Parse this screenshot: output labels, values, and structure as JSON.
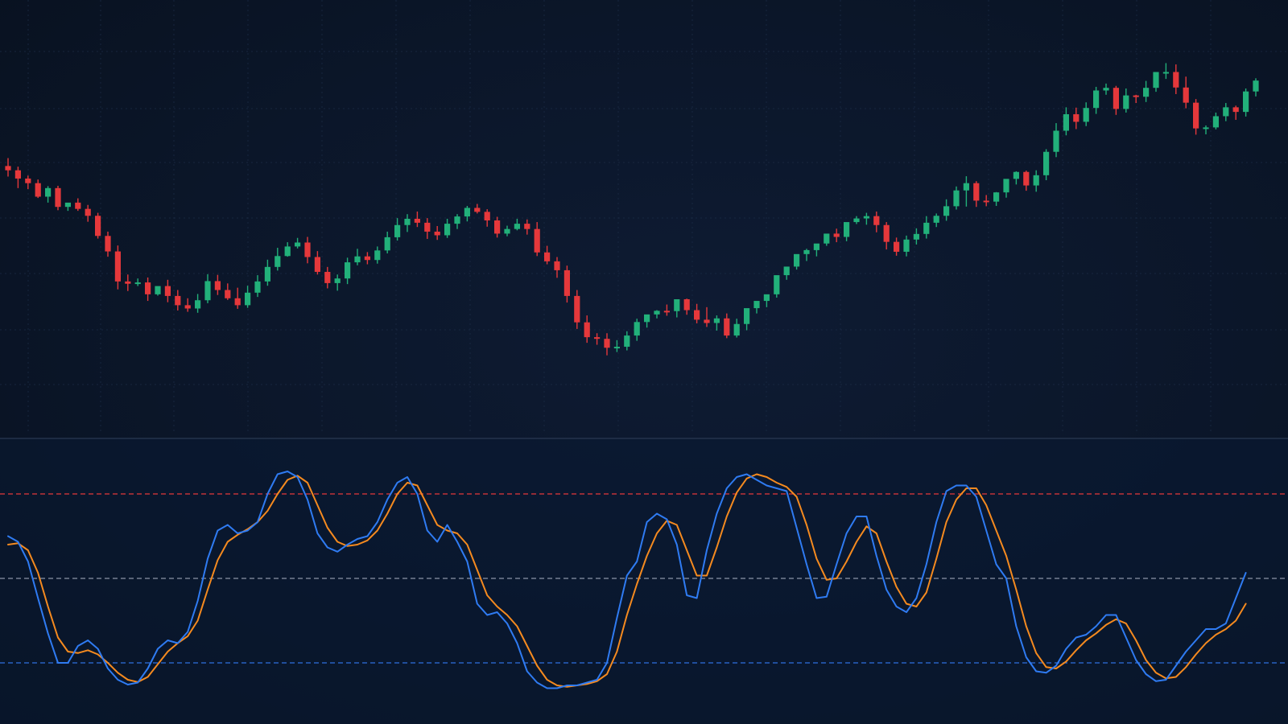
{
  "colors": {
    "bull": "#22b07a",
    "bear": "#e5383b",
    "k_line": "#2f7bf2",
    "d_line": "#f58a1f",
    "overbought_line": "#e5383b",
    "midline": "#8a94a6",
    "oversold_line": "#2f6fe0"
  },
  "chart_data": [
    {
      "type": "candlestick",
      "pane": "price",
      "grid": true,
      "legend": "none",
      "ylim": [
        0,
        100
      ],
      "x": [
        0,
        1,
        2,
        3,
        4,
        5,
        6,
        7,
        8,
        9,
        10,
        11,
        12,
        13,
        14,
        15,
        16,
        17,
        18,
        19,
        20,
        21,
        22,
        23,
        24,
        25,
        26,
        27,
        28,
        29,
        30,
        31,
        32,
        33,
        34,
        35,
        36,
        37,
        38,
        39,
        40,
        41,
        42,
        43,
        44,
        45,
        46,
        47,
        48,
        49,
        50,
        51,
        52,
        53,
        54,
        55,
        56,
        57,
        58,
        59,
        60,
        61,
        62,
        63,
        64,
        65,
        66,
        67,
        68,
        69,
        70,
        71,
        72,
        73,
        74,
        75,
        76,
        77,
        78,
        79,
        80,
        81,
        82,
        83,
        84,
        85,
        86,
        87,
        88,
        89,
        90,
        91,
        92,
        93,
        94,
        95,
        96,
        97,
        98,
        99,
        100,
        101,
        102,
        103,
        104,
        105,
        106,
        107,
        108,
        109,
        110,
        111,
        112,
        113,
        114,
        115,
        116,
        117,
        118,
        119,
        120,
        121,
        122,
        123,
        124,
        125
      ],
      "open": [
        70.4,
        69.1,
        66.6,
        65.2,
        61.1,
        63.7,
        58.0,
        59.3,
        57.4,
        55.3,
        49.2,
        44.5,
        35.4,
        34.7,
        35.1,
        31.5,
        34.0,
        31.0,
        28.2,
        27.2,
        29.7,
        35.5,
        32.8,
        30.3,
        28.2,
        32.0,
        35.4,
        39.8,
        43.1,
        46.0,
        47.2,
        42.8,
        38.3,
        34.9,
        36.3,
        41.2,
        43.0,
        41.9,
        44.8,
        48.8,
        52.5,
        54.4,
        53.2,
        50.5,
        49.4,
        52.9,
        55.1,
        57.7,
        56.5,
        53.9,
        49.9,
        51.3,
        52.9,
        51.3,
        44.2,
        41.5,
        38.8,
        31.0,
        23.0,
        18.5,
        18.0,
        15.3,
        15.6,
        19.0,
        23.1,
        25.4,
        26.5,
        26.4,
        30.0,
        26.7,
        23.8,
        22.8,
        24.2,
        19.0,
        22.5,
        27.3,
        29.5,
        31.5,
        37.3,
        39.9,
        43.7,
        44.9,
        46.9,
        49.9,
        48.9,
        53.4,
        54.5,
        55.2,
        52.5,
        47.4,
        44.4,
        48.1,
        49.8,
        53.2,
        55.3,
        58.2,
        63.0,
        65.2,
        59.9,
        59.6,
        62.4,
        66.5,
        68.6,
        64.5,
        67.6,
        74.7,
        81.1,
        86.1,
        83.8,
        88.0,
        93.3,
        94.1,
        87.7,
        91.8,
        91.4,
        94.1,
        98.9,
        98.9,
        94.2,
        89.6,
        81.8,
        82.1,
        85.5,
        88.2,
        86.8,
        93.0
      ],
      "close": [
        69.1,
        66.6,
        65.2,
        61.1,
        63.7,
        58.0,
        59.3,
        57.4,
        55.3,
        49.2,
        44.5,
        35.4,
        34.7,
        35.1,
        31.5,
        34.0,
        31.0,
        28.2,
        27.2,
        29.7,
        35.5,
        32.8,
        30.3,
        28.2,
        32.0,
        35.4,
        39.8,
        43.1,
        46.0,
        47.2,
        42.8,
        38.3,
        34.9,
        36.3,
        41.2,
        43.0,
        41.9,
        44.8,
        48.8,
        52.5,
        54.4,
        53.2,
        50.5,
        49.4,
        52.9,
        55.1,
        57.7,
        56.5,
        53.9,
        49.9,
        51.3,
        52.9,
        51.3,
        44.2,
        41.5,
        38.8,
        31.0,
        23.0,
        18.5,
        18.0,
        15.3,
        15.6,
        19.0,
        23.1,
        25.4,
        26.5,
        26.4,
        30.0,
        26.7,
        23.8,
        22.8,
        24.2,
        19.0,
        22.5,
        27.3,
        29.5,
        31.5,
        37.3,
        39.9,
        43.7,
        44.9,
        46.9,
        49.9,
        48.9,
        53.4,
        54.5,
        55.2,
        52.5,
        47.4,
        44.4,
        48.1,
        49.8,
        53.2,
        55.3,
        58.2,
        63.0,
        65.2,
        59.9,
        59.6,
        62.4,
        66.5,
        68.6,
        64.5,
        67.6,
        74.7,
        81.1,
        86.1,
        83.8,
        88.0,
        93.3,
        94.1,
        87.7,
        91.8,
        91.4,
        94.1,
        98.9,
        98.9,
        94.2,
        89.6,
        81.8,
        82.1,
        85.5,
        88.2,
        86.8,
        93.0,
        96.3
      ],
      "high": [
        72.8,
        70.2,
        67.5,
        66.3,
        64.3,
        64.4,
        58.7,
        60.6,
        58.6,
        56.2,
        50.5,
        46.3,
        37.5,
        36.3,
        36.6,
        33.0,
        35.9,
        32.8,
        30.3,
        31.6,
        37.6,
        37.4,
        34.8,
        33.5,
        34.1,
        37.3,
        42.0,
        45.6,
        47.3,
        48.6,
        48.9,
        44.6,
        39.8,
        37.5,
        42.6,
        45.3,
        44.3,
        46.0,
        50.5,
        54.6,
        55.8,
        56.6,
        54.6,
        52.2,
        54.4,
        55.8,
        58.3,
        58.9,
        57.3,
        55.0,
        52.3,
        54.4,
        54.2,
        53.4,
        46.2,
        42.8,
        40.2,
        32.8,
        25.1,
        19.7,
        19.7,
        17.6,
        20.3,
        24.1,
        25.0,
        26.7,
        28.4,
        28.1,
        30.2,
        28.6,
        27.6,
        25.1,
        25.7,
        24.1,
        23.7,
        29.0,
        30.9,
        33.6,
        38.4,
        41.9,
        45.3,
        46.3,
        48.8,
        51.4,
        50.3,
        55.2,
        56.2,
        56.6,
        53.4,
        48.7,
        49.3,
        51.5,
        55.2,
        56.0,
        60.3,
        64.2,
        67.3,
        65.8,
        61.6,
        62.5,
        64.6,
        68.8,
        69.0,
        69.1,
        75.5,
        83.4,
        88.2,
        88.1,
        89.7,
        94.4,
        95.4,
        94.7,
        93.9,
        92.0,
        96.2,
        98.5,
        101.6,
        101.2,
        97.5,
        90.7,
        82.7,
        86.6,
        89.5,
        88.7,
        93.9,
        97.0
      ],
      "low": [
        67.2,
        63.7,
        63.4,
        60.7,
        59.3,
        57.0,
        56.8,
        56.8,
        53.5,
        48.4,
        42.9,
        33.0,
        32.5,
        34.0,
        29.5,
        31.1,
        29.1,
        26.6,
        26.2,
        25.9,
        28.8,
        31.3,
        29.8,
        27.1,
        27.4,
        30.7,
        34.1,
        38.7,
        42.9,
        45.4,
        40.9,
        37.5,
        33.3,
        32.6,
        34.6,
        40.3,
        40.6,
        40.8,
        43.9,
        47.8,
        50.4,
        51.9,
        48.3,
        48.0,
        48.6,
        51.3,
        53.6,
        56.0,
        52.0,
        48.7,
        49.1,
        50.9,
        49.6,
        43.1,
        40.6,
        36.5,
        29.0,
        21.0,
        16.8,
        16.2,
        13.0,
        14.0,
        14.5,
        17.4,
        21.4,
        24.2,
        25.0,
        24.5,
        25.3,
        22.7,
        21.6,
        20.5,
        18.2,
        18.4,
        20.6,
        25.7,
        27.6,
        30.5,
        35.9,
        39.0,
        41.6,
        43.0,
        46.2,
        47.3,
        47.6,
        52.8,
        52.6,
        50.3,
        45.1,
        43.2,
        43.0,
        46.6,
        48.4,
        51.9,
        53.8,
        57.2,
        58.1,
        58.0,
        58.2,
        58.3,
        60.8,
        64.8,
        62.9,
        62.6,
        66.1,
        73.1,
        79.7,
        81.6,
        82.5,
        86.2,
        92.0,
        85.9,
        86.6,
        89.5,
        89.8,
        92.9,
        96.8,
        92.2,
        87.9,
        79.9,
        80.0,
        81.5,
        84.0,
        84.4,
        85.4,
        91.5
      ]
    },
    {
      "type": "line",
      "pane": "oscillator",
      "grid": false,
      "legend": "none",
      "ylim": [
        0,
        100
      ],
      "reference_lines": [
        80,
        50,
        20
      ],
      "x": [
        0,
        1,
        2,
        3,
        4,
        5,
        6,
        7,
        8,
        9,
        10,
        11,
        12,
        13,
        14,
        15,
        16,
        17,
        18,
        19,
        20,
        21,
        22,
        23,
        24,
        25,
        26,
        27,
        28,
        29,
        30,
        31,
        32,
        33,
        34,
        35,
        36,
        37,
        38,
        39,
        40,
        41,
        42,
        43,
        44,
        45,
        46,
        47,
        48,
        49,
        50,
        51,
        52,
        53,
        54,
        55,
        56,
        57,
        58,
        59,
        60,
        61,
        62,
        63,
        64,
        65,
        66,
        67,
        68,
        69,
        70,
        71,
        72,
        73,
        74,
        75,
        76,
        77,
        78,
        79,
        80,
        81,
        82,
        83,
        84,
        85,
        86,
        87,
        88,
        89,
        90,
        91,
        92,
        93,
        94,
        95,
        96,
        97,
        98,
        99,
        100,
        101,
        102,
        103,
        104,
        105,
        106,
        107,
        108,
        109,
        110,
        111,
        112,
        113,
        114,
        115,
        116,
        117,
        118,
        119,
        120,
        121,
        122,
        123,
        124
      ],
      "series": [
        {
          "color": "#2f7bf2",
          "values": [
            65.0,
            63.0,
            56.0,
            43.0,
            30.5,
            20.0,
            20.0,
            26.0,
            28.0,
            25.0,
            18.0,
            14.0,
            12.3,
            13.0,
            18.0,
            25.0,
            28.0,
            27.0,
            31.0,
            42.0,
            57.0,
            67.0,
            69.0,
            66.0,
            67.0,
            70.0,
            80.0,
            87.0,
            88.0,
            86.0,
            78.0,
            66.0,
            61.0,
            59.5,
            62.0,
            64.0,
            65.0,
            70.0,
            78.0,
            84.0,
            86.0,
            80.0,
            67.0,
            63.0,
            69.0,
            63.0,
            56.0,
            41.0,
            37.0,
            38.0,
            34.0,
            27.0,
            17.0,
            13.0,
            11.0,
            11.0,
            12.0,
            12.0,
            13.0,
            14.0,
            20.0,
            36.0,
            51.0,
            56.0,
            70.0,
            73.0,
            71.0,
            62.0,
            44.0,
            43.0,
            60.0,
            73.0,
            82.0,
            86.0,
            87.0,
            85.0,
            83.0,
            82.0,
            81.0,
            68.0,
            55.0,
            43.0,
            43.5,
            55.0,
            66.0,
            72.0,
            72.0,
            58.0,
            46.0,
            40.0,
            38.0,
            43.0,
            55.0,
            70.0,
            81.0,
            83.0,
            83.0,
            79.0,
            67.0,
            55.0,
            50.0,
            33.0,
            22.0,
            17.0,
            16.5,
            19.0,
            25.0,
            29.0,
            30.0,
            33.0,
            37.0,
            37.0,
            29.0,
            21.0,
            16.0,
            13.5,
            14.0,
            19.0,
            24.0,
            28.0,
            32.0,
            32.0,
            34.0,
            43.0,
            52.0,
            54.0
          ]
        },
        {
          "color": "#f58a1f",
          "values": [
            62.0,
            62.5,
            60.0,
            52.0,
            40.0,
            29.0,
            24.0,
            23.5,
            24.5,
            23.0,
            20.0,
            16.5,
            14.0,
            13.2,
            15.0,
            19.5,
            24.0,
            27.0,
            29.5,
            35.0,
            46.0,
            56.5,
            63.0,
            65.5,
            67.5,
            70.0,
            74.0,
            80.0,
            85.0,
            86.5,
            84.0,
            76.0,
            68.0,
            63.0,
            61.5,
            62.0,
            63.5,
            67.0,
            73.0,
            80.0,
            84.0,
            83.0,
            76.0,
            69.0,
            67.0,
            66.0,
            62.0,
            53.0,
            44.0,
            40.0,
            37.0,
            33.0,
            26.0,
            19.0,
            14.0,
            12.0,
            11.5,
            12.0,
            12.5,
            13.5,
            16.0,
            24.0,
            37.0,
            48.0,
            58.0,
            66.0,
            70.5,
            69.0,
            60.0,
            51.0,
            51.0,
            61.0,
            72.0,
            80.5,
            85.5,
            87.0,
            86.0,
            84.0,
            82.5,
            79.0,
            69.0,
            57.0,
            49.5,
            50.0,
            56.0,
            63.0,
            68.5,
            66.0,
            56.0,
            47.0,
            41.0,
            40.0,
            45.0,
            57.0,
            70.0,
            78.0,
            82.0,
            82.0,
            76.0,
            67.0,
            58.0,
            46.0,
            33.0,
            23.5,
            18.5,
            18.0,
            20.5,
            24.5,
            28.0,
            30.5,
            33.5,
            35.5,
            34.0,
            28.0,
            21.0,
            16.5,
            14.5,
            15.0,
            18.5,
            23.0,
            27.0,
            30.0,
            32.0,
            35.0,
            41.0,
            47.0
          ]
        }
      ]
    }
  ]
}
